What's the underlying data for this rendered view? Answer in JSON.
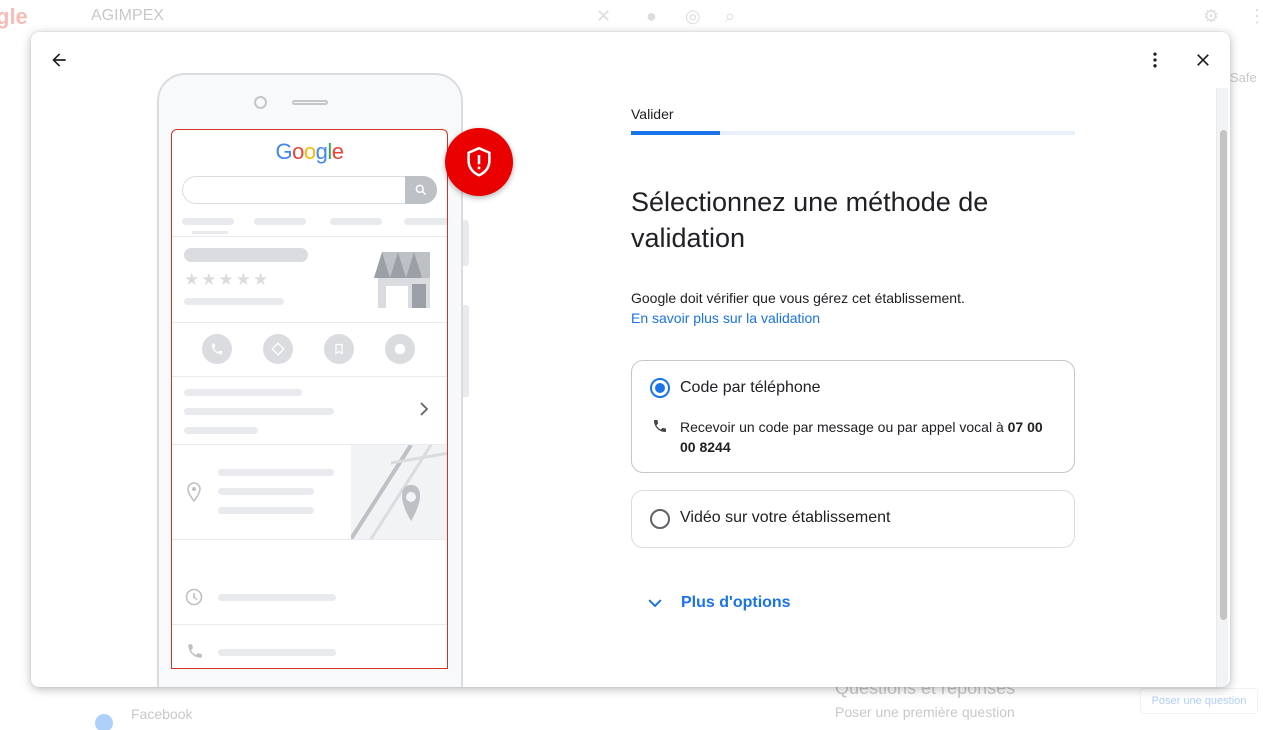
{
  "background": {
    "logo_text": "gle",
    "search_query": "AGIMPEX",
    "side_text": "Safe",
    "facebook_label": "Facebook",
    "qa_title": "Questions et réponses",
    "qa_subtitle": "Poser une première question",
    "ask_button": "Poser une question"
  },
  "dialog": {
    "phone_illustration": {
      "logo": [
        "G",
        "o",
        "o",
        "g",
        "l",
        "e"
      ],
      "stars": "★★★★★"
    },
    "step": {
      "label": "Valider",
      "progress": 0.2
    },
    "title": "Sélectionnez une méthode de validation",
    "description": "Google doit vérifier que vous gérez cet établissement.",
    "learn_more": "En savoir plus sur la validation",
    "options": [
      {
        "title": "Code par téléphone",
        "selected": true,
        "detail_prefix": "Recevoir un code par message ou par appel vocal à ",
        "detail_number": "07 00 00 8244"
      },
      {
        "title": "Vidéo sur votre établissement",
        "selected": false
      }
    ],
    "more_options": "Plus d'options"
  },
  "colors": {
    "accent": "#1a73e8",
    "alert": "#ea0000",
    "screen_border": "#d93025"
  }
}
